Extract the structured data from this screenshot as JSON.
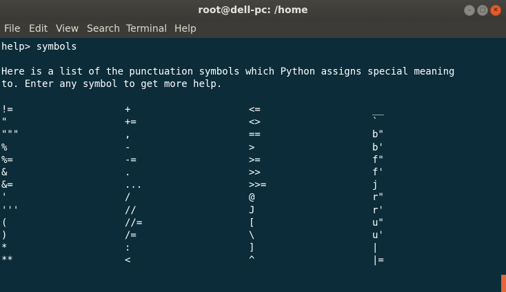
{
  "window": {
    "title": "root@dell-pc: /home"
  },
  "menu": [
    "File",
    "Edit",
    "View",
    "Search",
    "Terminal",
    "Help"
  ],
  "terminal": {
    "prompt_line": "help> symbols",
    "intro_1": "Here is a list of the punctuation symbols which Python assigns special meaning",
    "intro_2": "to. Enter any symbol to get more help.",
    "columns": [
      [
        "!=",
        "\"",
        "\"\"\"",
        "%",
        "%=",
        "&",
        "&=",
        "'",
        "'''",
        "(",
        ")",
        "*",
        "**"
      ],
      [
        "+",
        "+=",
        ",",
        "-",
        "-=",
        ".",
        "...",
        "/",
        "//",
        "//=",
        "/=",
        ":",
        "<"
      ],
      [
        "<=",
        "<>",
        "==",
        ">",
        ">=",
        ">>",
        ">>=",
        "@",
        "J",
        "[",
        "\\",
        "]",
        "^"
      ],
      [
        "__",
        "`",
        "b\"",
        "b'",
        "f\"",
        "f'",
        "j",
        "r\"",
        "r'",
        "u\"",
        "u'",
        "|",
        "|="
      ]
    ]
  }
}
